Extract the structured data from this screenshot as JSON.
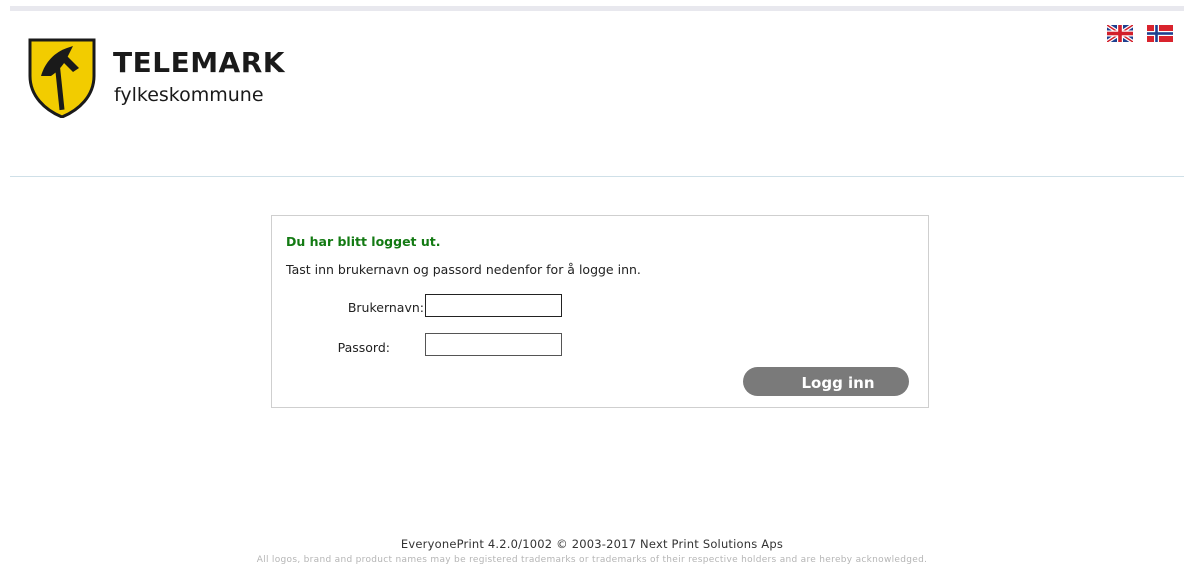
{
  "header": {
    "brand": "TELEMARK",
    "subtitle": "fylkeskommune"
  },
  "languages": [
    {
      "name": "English",
      "icon": "uk-flag-icon"
    },
    {
      "name": "Norsk",
      "icon": "norway-flag-icon"
    }
  ],
  "login": {
    "message": "Du har blitt logget ut.",
    "instruction": "Tast inn brukernavn og passord nedenfor for å logge inn.",
    "username_label": "Brukernavn:",
    "username_value": "",
    "password_label": "Passord:",
    "password_value": "",
    "submit_label": "Logg inn"
  },
  "footer": {
    "version": "EveryonePrint 4.2.0/1002 © 2003-2017 Next Print Solutions Aps",
    "legal": "All logos, brand and product names may be registered trademarks or trademarks of their respective holders and are hereby acknowledged."
  },
  "colors": {
    "message": "#137a13",
    "button": "#7a7a7a",
    "shield_yellow": "#f2cc00"
  }
}
